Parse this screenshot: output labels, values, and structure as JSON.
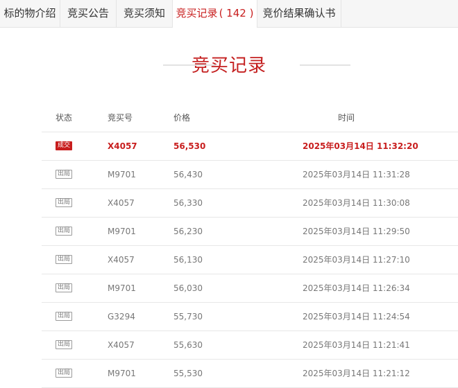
{
  "tabs": [
    {
      "label": "标的物介绍"
    },
    {
      "label": "竞买公告"
    },
    {
      "label": "竞买须知"
    },
    {
      "label": "竞买记录",
      "count": "( 142 )"
    },
    {
      "label": "竞价结果确认书"
    }
  ],
  "section_title": "竞买记录",
  "table": {
    "headers": {
      "status": "状态",
      "bid_no": "竞买号",
      "price": "价格",
      "time": "时间"
    },
    "rows": [
      {
        "status": "成交",
        "bid_no": "X4057",
        "price": "56,530",
        "time": "2025年03月14日 11:32:20"
      },
      {
        "status": "出局",
        "bid_no": "M9701",
        "price": "56,430",
        "time": "2025年03月14日 11:31:28"
      },
      {
        "status": "出局",
        "bid_no": "X4057",
        "price": "56,330",
        "time": "2025年03月14日 11:30:08"
      },
      {
        "status": "出局",
        "bid_no": "M9701",
        "price": "56,230",
        "time": "2025年03月14日 11:29:50"
      },
      {
        "status": "出局",
        "bid_no": "X4057",
        "price": "56,130",
        "time": "2025年03月14日 11:27:10"
      },
      {
        "status": "出局",
        "bid_no": "M9701",
        "price": "56,030",
        "time": "2025年03月14日 11:26:34"
      },
      {
        "status": "出局",
        "bid_no": "G3294",
        "price": "55,730",
        "time": "2025年03月14日 11:24:54"
      },
      {
        "status": "出局",
        "bid_no": "X4057",
        "price": "55,630",
        "time": "2025年03月14日 11:21:41"
      },
      {
        "status": "出局",
        "bid_no": "M9701",
        "price": "55,530",
        "time": "2025年03月14日 11:21:12"
      }
    ]
  },
  "colors": {
    "accent": "#c81e1e"
  }
}
